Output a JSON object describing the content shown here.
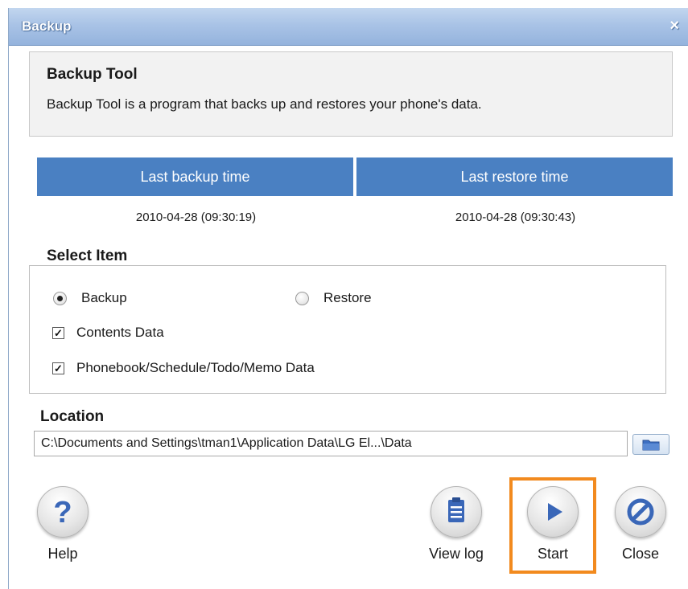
{
  "window": {
    "title": "Backup",
    "close_glyph": "×"
  },
  "info": {
    "title": "Backup Tool",
    "description": "Backup Tool is a program that backs up and restores your phone's data."
  },
  "times": {
    "backup_header": "Last backup time",
    "restore_header": "Last restore time",
    "backup_value": "2010-04-28 (09:30:19)",
    "restore_value": "2010-04-28 (09:30:43)"
  },
  "select_item": {
    "legend": "Select Item",
    "mode_options": [
      {
        "label": "Backup",
        "selected": true
      },
      {
        "label": "Restore",
        "selected": false
      }
    ],
    "checkboxes": [
      {
        "label": "Contents Data",
        "checked": true
      },
      {
        "label": "Phonebook/Schedule/Todo/Memo Data",
        "checked": true
      }
    ]
  },
  "location": {
    "label": "Location",
    "value": "C:\\Documents and Settings\\tman1\\Application Data\\LG El...\\Data",
    "browse_icon": "folder-icon"
  },
  "buttons": {
    "help": {
      "label": "Help",
      "icon": "question-icon"
    },
    "view_log": {
      "label": "View log",
      "icon": "clipboard-icon"
    },
    "start": {
      "label": "Start",
      "icon": "play-icon"
    },
    "close": {
      "label": "Close",
      "icon": "no-entry-icon"
    }
  },
  "colors": {
    "header_blue": "#4a80c2",
    "highlight_orange": "#f28a1e",
    "icon_blue": "#3a67b8"
  }
}
